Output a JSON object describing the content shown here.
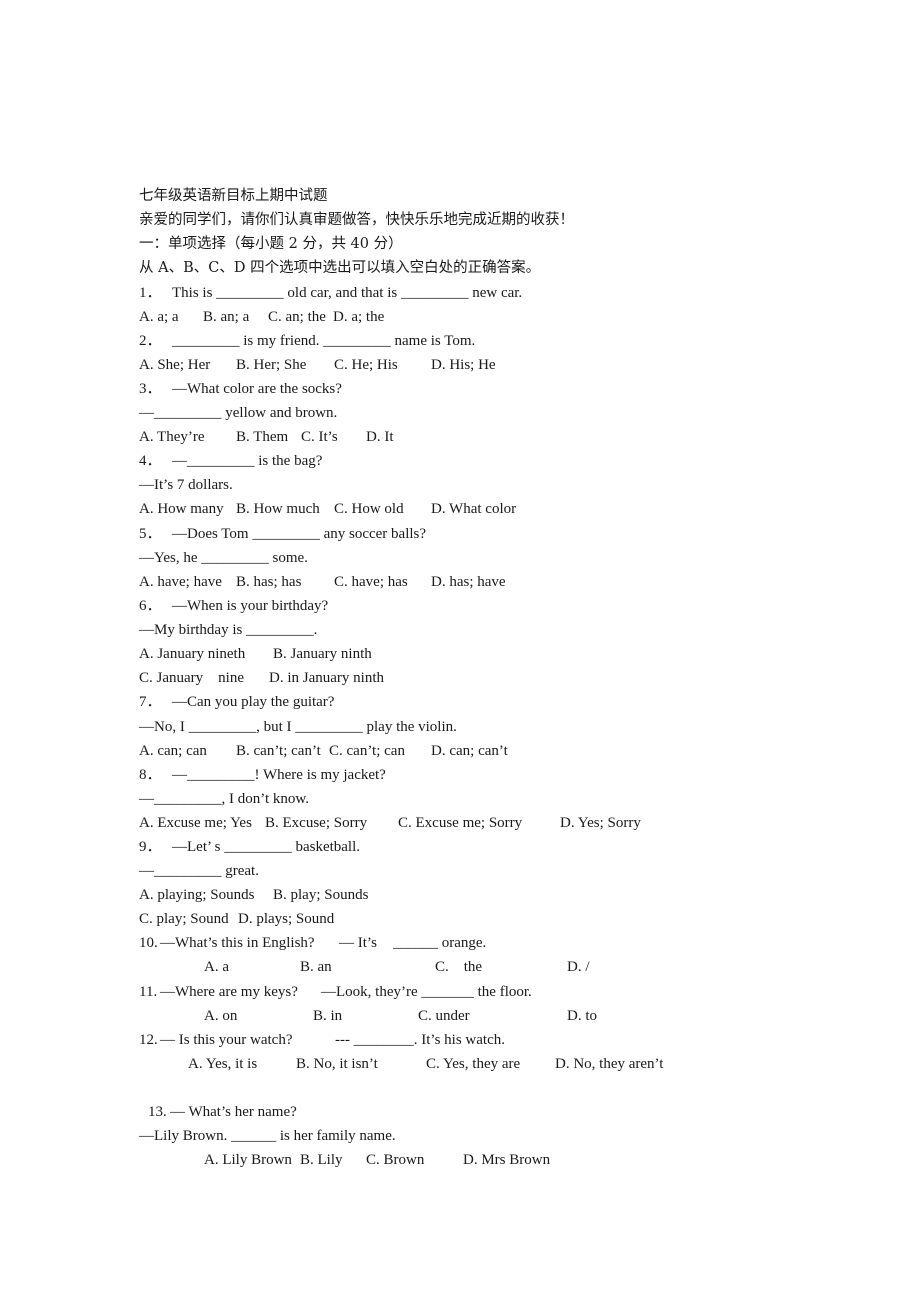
{
  "document": {
    "title": "七年级英语新目标上期中试题",
    "greeting": "亲爱的同学们，请你们认真审题做答，快快乐乐地完成近期的收获！",
    "section_heading": "一：单项选择（每小题 2 分，共 40 分）",
    "instruction": "从 A、B、C、D 四个选项中选出可以填入空白处的正确答案。",
    "questions": [
      {
        "number": "1．",
        "lines": [
          "This is _________ old car, and that is _________ new car."
        ],
        "options": [
          "A. a; a",
          "B. an; a",
          "C. an; the",
          "D. a; the"
        ]
      },
      {
        "number": "2．",
        "lines": [
          "_________ is my friend. _________ name is Tom."
        ],
        "options": [
          "A. She; Her",
          "B. Her; She",
          "C. He; His",
          "D. His; He"
        ]
      },
      {
        "number": "3．",
        "lines": [
          "—What color are the socks?",
          "—_________ yellow and brown."
        ],
        "options": [
          "A. They’re",
          "B. Them",
          "C. It’s",
          "D. It"
        ]
      },
      {
        "number": "4．",
        "lines": [
          "—_________ is the bag?",
          "—It’s 7 dollars."
        ],
        "options": [
          "A. How many",
          "B. How much",
          "C. How old",
          "D. What color"
        ]
      },
      {
        "number": "5．",
        "lines": [
          "—Does Tom _________ any soccer balls?",
          "—Yes, he _________ some."
        ],
        "options": [
          "A. have; have",
          "B. has; has",
          "C. have; has",
          "D. has; have"
        ]
      },
      {
        "number": "6．",
        "lines": [
          "—When is your birthday?",
          "—My birthday is _________."
        ],
        "options": [
          "A. January nineth",
          "B. January ninth",
          "C. January    nine",
          "D. in January ninth"
        ]
      },
      {
        "number": "7．",
        "lines": [
          "—Can you play the guitar?",
          "—No, I _________, but I _________ play the violin."
        ],
        "options": [
          "A. can; can",
          "B. can’t; can’t",
          "C. can’t; can",
          "D. can; can’t"
        ]
      },
      {
        "number": "8．",
        "lines": [
          "—_________! Where is my jacket?",
          "—_________, I don’t know."
        ],
        "options": [
          "A. Excuse me; Yes",
          "B. Excuse; Sorry",
          "C. Excuse me; Sorry",
          "D. Yes; Sorry"
        ]
      },
      {
        "number": "9．",
        "lines": [
          "—Let’ s _________ basketball.",
          "—_________ great."
        ],
        "options": [
          "A. playing; Sounds",
          "B. play; Sounds",
          "C. play; Sound",
          "D. plays; Sound"
        ]
      },
      {
        "number": "10.",
        "lines": [
          "—What’s this in English?",
          "— It’s",
          "______ orange."
        ],
        "options": [
          "A. a",
          "B. an",
          "C.    the",
          "D. /"
        ]
      },
      {
        "number": "11.",
        "lines": [
          "—Where are my keys?",
          "—Look, they’re _______ the floor."
        ],
        "options": [
          "A. on",
          "B. in",
          "C. under",
          "D. to"
        ]
      },
      {
        "number": "12.",
        "lines": [
          "— Is this your watch?",
          "--- ________. It’s his watch."
        ],
        "options": [
          "A. Yes, it is",
          "B. No, it isn’t",
          "C. Yes, they are",
          "D. No, they aren’t"
        ]
      },
      {
        "number": "13.",
        "lines": [
          "— What’s her name?",
          "—Lily Brown. ______ is her family name."
        ],
        "options": [
          "A. Lily Brown",
          "B. Lily",
          "C. Brown",
          "D. Mrs Brown"
        ]
      }
    ]
  }
}
